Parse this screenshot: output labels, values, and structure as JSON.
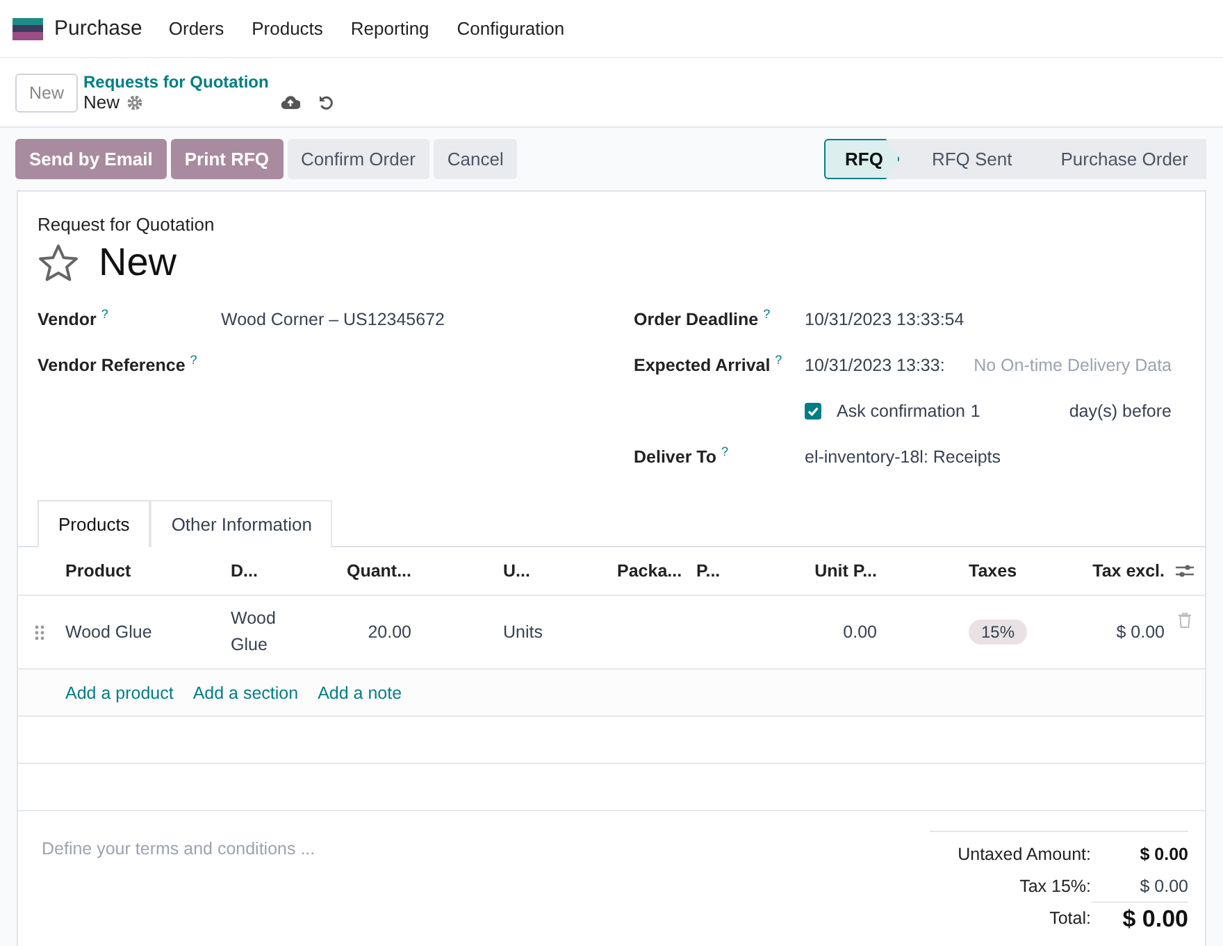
{
  "app_menu": {
    "brand": "Purchase",
    "items": [
      "Orders",
      "Products",
      "Reporting",
      "Configuration"
    ]
  },
  "control_panel": {
    "new_button": "New",
    "breadcrumb": "Requests for Quotation",
    "record": "New"
  },
  "actions": [
    {
      "label": "Send by Email",
      "kind": "primary"
    },
    {
      "label": "Print RFQ",
      "kind": "primary"
    },
    {
      "label": "Confirm Order",
      "kind": "secondary"
    },
    {
      "label": "Cancel",
      "kind": "secondary"
    }
  ],
  "stages": [
    {
      "label": "RFQ",
      "selected": true
    },
    {
      "label": "RFQ Sent",
      "selected": false
    },
    {
      "label": "Purchase Order",
      "selected": false
    }
  ],
  "form": {
    "subtitle": "Request for Quotation",
    "title": "New",
    "starred": false,
    "left_fields": [
      {
        "label": "Vendor",
        "help": "?",
        "value": "Wood Corner – US12345672"
      },
      {
        "label": "Vendor Reference",
        "help": "?"
      }
    ],
    "right_fields": [
      {
        "label": "Order Deadline",
        "help": "?",
        "value": "10/31/2023 13:33:54"
      },
      {
        "label": "Expected Arrival",
        "help": "?",
        "value": "10/31/2023 13:33:",
        "note": "No On-time Delivery Data"
      }
    ],
    "ask_confirmation": {
      "checked": true,
      "label": "Ask confirmation",
      "days": "1",
      "suffix": "day(s) before"
    },
    "deliver_to": {
      "label": "Deliver To",
      "help": "?",
      "value": "el-inventory-18l: Receipts"
    }
  },
  "tabs": [
    {
      "label": "Products",
      "selected": true
    },
    {
      "label": "Other Information",
      "selected": false
    }
  ],
  "table": {
    "columns": [
      "Product",
      "D...",
      "Quant...",
      "U...",
      "Packa...",
      "P...",
      "Unit P...",
      "Taxes",
      "Tax excl."
    ],
    "rows": [
      {
        "product": "Wood Glue",
        "description": "Wood Glue",
        "quantity": "20.00",
        "unit": "Units",
        "unit_price": "0.00",
        "taxes": "15%",
        "tax_excl": "$ 0.00"
      }
    ],
    "add_links": [
      "Add a product",
      "Add a section",
      "Add a note"
    ]
  },
  "terms": {
    "placeholder": "Define your terms and conditions ..."
  },
  "totals": [
    {
      "label": "Untaxed Amount:",
      "value": "$ 0.00",
      "kind": "bold"
    },
    {
      "label": "Tax 15%:",
      "value": "$ 0.00",
      "kind": "plain"
    },
    {
      "label": "Total:",
      "value": "$ 0.00",
      "kind": "grand"
    }
  ]
}
